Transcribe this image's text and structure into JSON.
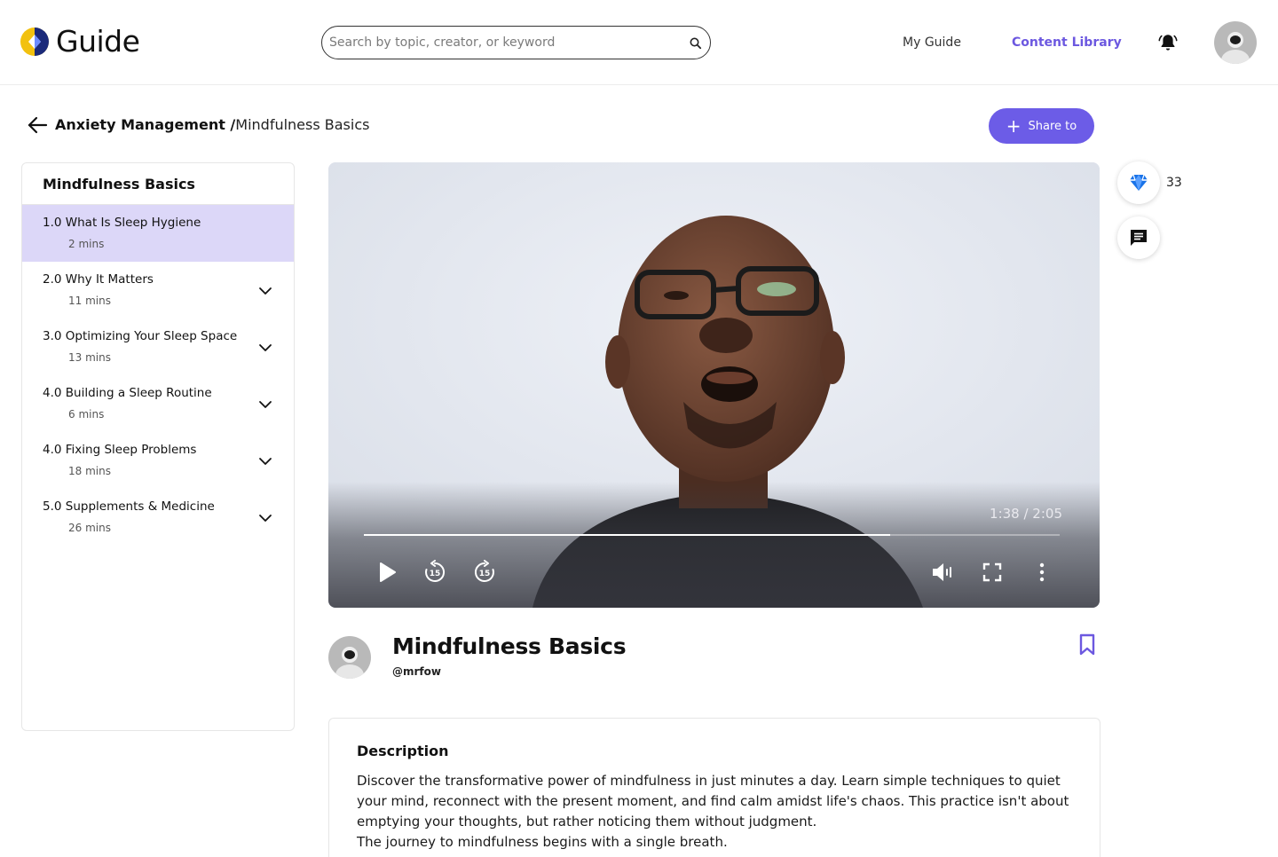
{
  "header": {
    "logo_text": "Guide",
    "search_placeholder": "Search by topic, creator, or keyword",
    "nav": {
      "my_guide": "My Guide",
      "content_library": "Content Library"
    },
    "accent_color": "#6c58e0"
  },
  "breadcrumb": {
    "parent": "Anxiety Management /",
    "current": "Mindfulness Basics"
  },
  "share_button": {
    "label": "Share to"
  },
  "sidebar": {
    "title": "Mindfulness Basics",
    "chapters": [
      {
        "label": "1.0 What Is Sleep Hygiene",
        "duration": "2 mins",
        "active": true
      },
      {
        "label": "2.0 Why It Matters",
        "duration": "11 mins",
        "active": false
      },
      {
        "label": "3.0 Optimizing Your Sleep Space",
        "duration": "13 mins",
        "active": false
      },
      {
        "label": "4.0 Building a Sleep Routine",
        "duration": "6 mins",
        "active": false
      },
      {
        "label": "4.0 Fixing Sleep Problems",
        "duration": "18 mins",
        "active": false
      },
      {
        "label": "5.0 Supplements & Medicine",
        "duration": "26 mins",
        "active": false
      }
    ]
  },
  "player": {
    "time_readout": "1:38 / 2:05",
    "progress": 0.757,
    "skip_back_seconds": "15",
    "skip_forward_seconds": "15"
  },
  "engagement": {
    "like_count": "33"
  },
  "content": {
    "title": "Mindfulness Basics",
    "creator_handle": "@mrfow"
  },
  "description": {
    "heading": "Description",
    "paragraph_1": "Discover the transformative power of mindfulness in just minutes a day. Learn simple techniques to quiet your mind, reconnect with the present moment, and find calm amidst life's chaos. This practice isn't about emptying your thoughts, but rather noticing them without judgment.",
    "paragraph_2": "The journey to mindfulness begins with a single breath."
  }
}
